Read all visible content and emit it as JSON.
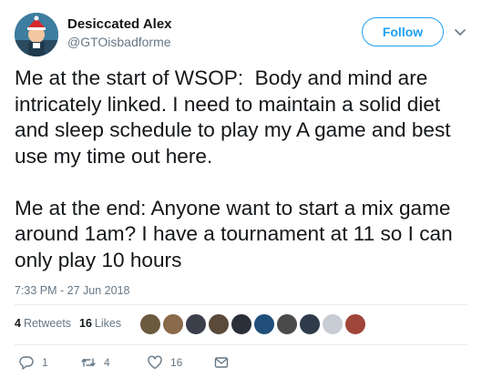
{
  "author": {
    "display_name": "Desiccated Alex",
    "handle": "@GTOisbadforme"
  },
  "follow_button": {
    "label": "Follow"
  },
  "tweet": {
    "text": "Me at the start of WSOP:  Body and mind are intricately linked. I need to maintain a solid diet and sleep schedule to play my A game and best use my time out here.\n\nMe at the end: Anyone want to start a mix game around 1am? I have a tournament at 11 so I can only play 10 hours",
    "timestamp": "7:33 PM - 27 Jun 2018"
  },
  "stats": {
    "retweets_count": "4",
    "retweets_label": "Retweets",
    "likes_count": "16",
    "likes_label": "Likes",
    "liker_avatar_colors": [
      "#6b5a3e",
      "#8a6a4a",
      "#3a3f4a",
      "#5a4a3a",
      "#2a2f3a",
      "#1f4f7a",
      "#4a4a4a",
      "#2f3a4a",
      "#c7cdd3",
      "#a0453a"
    ]
  },
  "actions": {
    "reply_count": "1",
    "retweet_count": "4",
    "like_count": "16"
  },
  "colors": {
    "accent": "#1da1f2",
    "secondary_text": "#657786",
    "primary_text": "#14171a",
    "divider": "#e6ecf0"
  },
  "icons": {
    "avatar": "profile-avatar",
    "caret": "chevron-down-icon",
    "reply": "reply-icon",
    "retweet": "retweet-icon",
    "like": "heart-icon",
    "dm": "envelope-icon"
  }
}
